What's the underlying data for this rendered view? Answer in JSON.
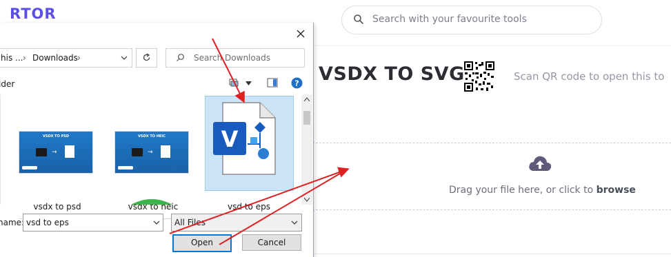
{
  "page": {
    "logo": "RTOR",
    "search_placeholder": "Search with your favourite tools",
    "title": "VSDX TO SVG",
    "qr_text": "Scan QR code to open this to",
    "drop_prefix": "Drag your file here, or click to ",
    "drop_link": "browse"
  },
  "dialog": {
    "breadcrumb": [
      "his ...",
      "Downloads"
    ],
    "search_placeholder": "Search Downloads",
    "toolbar_label": "lder",
    "files": [
      {
        "label": "vsdx to psd",
        "thumb_title": "VSDX TO PSD"
      },
      {
        "label": "vsdx to heic",
        "thumb_title": "VSDX TO HEIC"
      },
      {
        "label": "vsd to eps",
        "selected": true
      }
    ],
    "filename_label": "name:",
    "filename_value": "vsd to eps",
    "filetype_value": "All Files",
    "open_label": "Open",
    "cancel_label": "Cancel"
  },
  "colors": {
    "accent": "#5b4fe0",
    "visio": "#185abd",
    "annotation_arrow": "#e02020",
    "selection": "#cce4f7"
  }
}
